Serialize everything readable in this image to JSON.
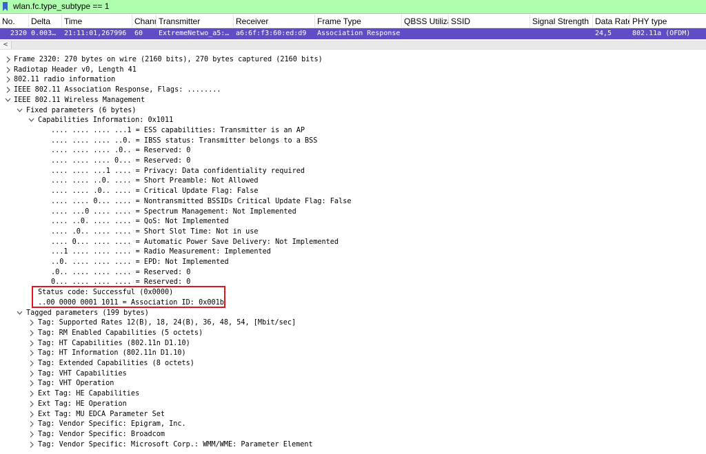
{
  "filter": {
    "text": "wlan.fc.type_subtype == 1",
    "bg_color": "#afffaf"
  },
  "columns": [
    {
      "label": "No."
    },
    {
      "label": "Delta"
    },
    {
      "label": "Time"
    },
    {
      "label": "Chanr"
    },
    {
      "label": "Transmitter"
    },
    {
      "label": "Receiver"
    },
    {
      "label": "Frame Type"
    },
    {
      "label": "QBSS Utiliza"
    },
    {
      "label": "SSID"
    },
    {
      "label": "Signal Strength"
    },
    {
      "label": "Data Rate"
    },
    {
      "label": "PHY type"
    }
  ],
  "packet": {
    "row_color": "#5e4dc5",
    "cells": [
      "2320",
      "0.003…",
      "21:11:01,267996",
      "60",
      "ExtremeNetwo_a5:…",
      "a6:6f:f3:60:ed:d9",
      "Association Response",
      "",
      "",
      "",
      "24,5",
      "802.11a (OFDM)"
    ]
  },
  "scroll": {
    "left_arrow": "<"
  },
  "tree": [
    {
      "text": "Frame 2320: 270 bytes on wire (2160 bits), 270 bytes captured (2160 bits)",
      "level": 0,
      "arrow": "collapsed"
    },
    {
      "text": "Radiotap Header v0, Length 41",
      "level": 0,
      "arrow": "collapsed"
    },
    {
      "text": "802.11 radio information",
      "level": 0,
      "arrow": "collapsed"
    },
    {
      "text": "IEEE 802.11 Association Response, Flags: ........",
      "level": 0,
      "arrow": "collapsed"
    },
    {
      "text": "IEEE 802.11 Wireless Management",
      "level": 0,
      "arrow": "expanded"
    },
    {
      "text": "Fixed parameters (6 bytes)",
      "level": 1,
      "arrow": "expanded"
    },
    {
      "text": "Capabilities Information: 0x1011",
      "level": 2,
      "arrow": "expanded"
    },
    {
      "text": ".... .... .... ...1 = ESS capabilities: Transmitter is an AP",
      "level": 3,
      "arrow": "none"
    },
    {
      "text": ".... .... .... ..0. = IBSS status: Transmitter belongs to a BSS",
      "level": 3,
      "arrow": "none"
    },
    {
      "text": ".... .... .... .0.. = Reserved: 0",
      "level": 3,
      "arrow": "none"
    },
    {
      "text": ".... .... .... 0... = Reserved: 0",
      "level": 3,
      "arrow": "none"
    },
    {
      "text": ".... .... ...1 .... = Privacy: Data confidentiality required",
      "level": 3,
      "arrow": "none"
    },
    {
      "text": ".... .... ..0. .... = Short Preamble: Not Allowed",
      "level": 3,
      "arrow": "none"
    },
    {
      "text": ".... .... .0.. .... = Critical Update Flag: False",
      "level": 3,
      "arrow": "none"
    },
    {
      "text": ".... .... 0... .... = Nontransmitted BSSIDs Critical Update Flag: False",
      "level": 3,
      "arrow": "none"
    },
    {
      "text": ".... ...0 .... .... = Spectrum Management: Not Implemented",
      "level": 3,
      "arrow": "none"
    },
    {
      "text": ".... ..0. .... .... = QoS: Not Implemented",
      "level": 3,
      "arrow": "none"
    },
    {
      "text": ".... .0.. .... .... = Short Slot Time: Not in use",
      "level": 3,
      "arrow": "none"
    },
    {
      "text": ".... 0... .... .... = Automatic Power Save Delivery: Not Implemented",
      "level": 3,
      "arrow": "none"
    },
    {
      "text": "...1 .... .... .... = Radio Measurement: Implemented",
      "level": 3,
      "arrow": "none"
    },
    {
      "text": "..0. .... .... .... = EPD: Not Implemented",
      "level": 3,
      "arrow": "none"
    },
    {
      "text": ".0.. .... .... .... = Reserved: 0",
      "level": 3,
      "arrow": "none"
    },
    {
      "text": "0... .... .... .... = Reserved: 0",
      "level": 3,
      "arrow": "none"
    },
    {
      "text": "Status code: Successful (0x0000)",
      "level": 2,
      "arrow": "none"
    },
    {
      "text": "..00 0000 0001 1011 = Association ID: 0x001b",
      "level": 2,
      "arrow": "none"
    },
    {
      "text": "Tagged parameters (199 bytes)",
      "level": 1,
      "arrow": "expanded"
    },
    {
      "text": "Tag: Supported Rates 12(B), 18, 24(B), 36, 48, 54, [Mbit/sec]",
      "level": 2,
      "arrow": "collapsed"
    },
    {
      "text": "Tag: RM Enabled Capabilities (5 octets)",
      "level": 2,
      "arrow": "collapsed"
    },
    {
      "text": "Tag: HT Capabilities (802.11n D1.10)",
      "level": 2,
      "arrow": "collapsed"
    },
    {
      "text": "Tag: HT Information (802.11n D1.10)",
      "level": 2,
      "arrow": "collapsed"
    },
    {
      "text": "Tag: Extended Capabilities (8 octets)",
      "level": 2,
      "arrow": "collapsed"
    },
    {
      "text": "Tag: VHT Capabilities",
      "level": 2,
      "arrow": "collapsed"
    },
    {
      "text": "Tag: VHT Operation",
      "level": 2,
      "arrow": "collapsed"
    },
    {
      "text": "Ext Tag: HE Capabilities",
      "level": 2,
      "arrow": "collapsed"
    },
    {
      "text": "Ext Tag: HE Operation",
      "level": 2,
      "arrow": "collapsed"
    },
    {
      "text": "Ext Tag: MU EDCA Parameter Set",
      "level": 2,
      "arrow": "collapsed"
    },
    {
      "text": "Tag: Vendor Specific: Epigram, Inc.",
      "level": 2,
      "arrow": "collapsed"
    },
    {
      "text": "Tag: Vendor Specific: Broadcom",
      "level": 2,
      "arrow": "collapsed"
    },
    {
      "text": "Tag: Vendor Specific: Microsoft Corp.: WMM/WME: Parameter Element",
      "level": 2,
      "arrow": "collapsed"
    }
  ],
  "highlight": {
    "color": "#e0141e"
  }
}
